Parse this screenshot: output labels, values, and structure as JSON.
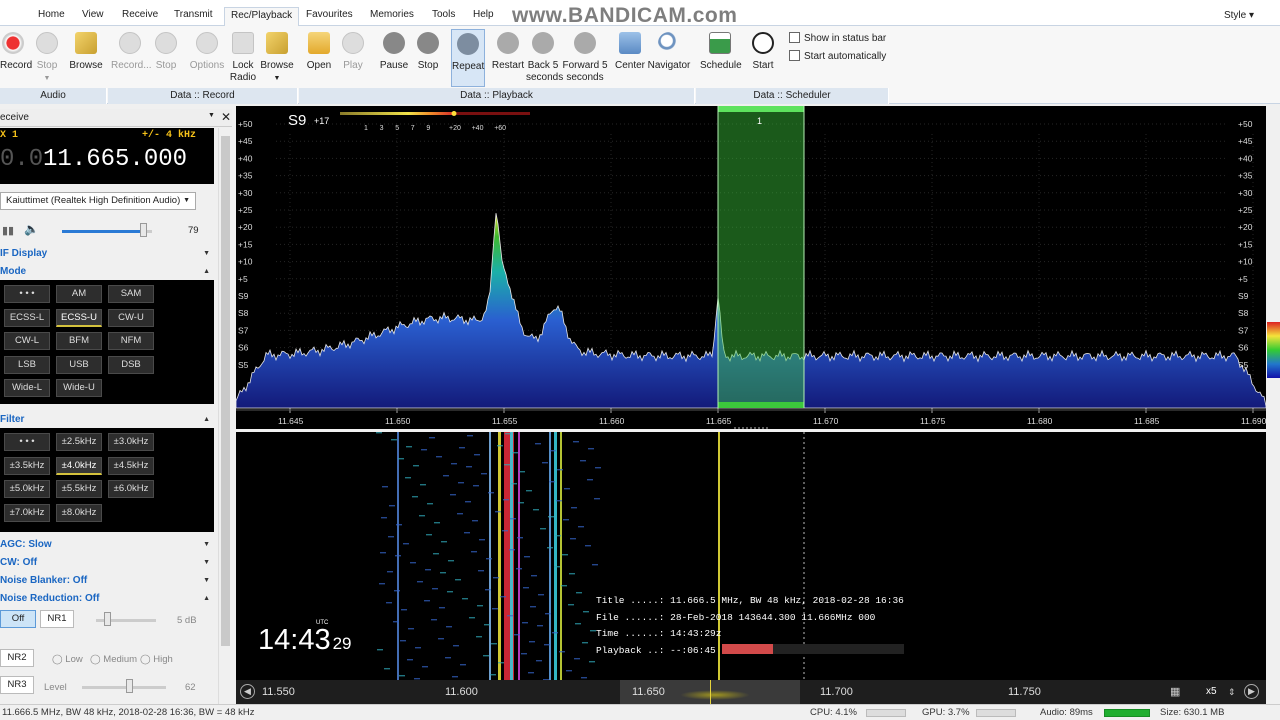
{
  "tabs": [
    "Home",
    "View",
    "Receive",
    "Transmit",
    "Rec/Playback",
    "Favourites",
    "Memories",
    "Tools",
    "Help"
  ],
  "active_tab": "Rec/Playback",
  "watermark": "www.BANDICAM.com",
  "style_menu": "Style",
  "ribbon": {
    "audio": {
      "record": "Record",
      "stop": "Stop",
      "browse": "Browse",
      "label": "Audio"
    },
    "data_record": {
      "record": "Record...",
      "stop": "Stop",
      "options": "Options",
      "lock_radio": "Lock Radio",
      "browse": "Browse",
      "label": "Data :: Record"
    },
    "data_playback": {
      "open": "Open",
      "play": "Play",
      "pause": "Pause",
      "stop": "Stop",
      "repeat": "Repeat",
      "restart": "Restart",
      "back5": "Back 5 seconds",
      "forward5": "Forward 5 seconds",
      "center": "Center",
      "navigator": "Navigator",
      "label": "Data :: Playback"
    },
    "data_scheduler": {
      "schedule": "Schedule",
      "start": "Start",
      "label": "Data :: Scheduler"
    },
    "show_status_bar": "Show in status bar",
    "start_automatically": "Start automatically"
  },
  "left": {
    "receive_title": "eceive",
    "rx_label": "X 1",
    "bw_label": "+/- 4 kHz",
    "freq_dim": "0.0",
    "freq": "11.665.000",
    "audio_device": "Kaiuttimet (Realtek High Definition Audio)",
    "volume": "79",
    "if_display": "IF Display",
    "mode_header": "Mode",
    "modes": [
      [
        "• • •",
        "AM",
        "SAM"
      ],
      [
        "ECSS-L",
        "ECSS-U",
        "CW-U"
      ],
      [
        "CW-L",
        "BFM",
        "NFM"
      ],
      [
        "LSB",
        "USB",
        "DSB"
      ],
      [
        "Wide-L",
        "Wide-U"
      ]
    ],
    "selected_mode": "ECSS-U",
    "filter_header": "Filter",
    "filters": [
      [
        "• • •",
        "±2.5kHz",
        "±3.0kHz"
      ],
      [
        "±3.5kHz",
        "±4.0kHz",
        "±4.5kHz"
      ],
      [
        "±5.0kHz",
        "±5.5kHz",
        "±6.0kHz"
      ],
      [
        "±7.0kHz",
        "±8.0kHz"
      ]
    ],
    "selected_filter": "±4.0kHz",
    "agc": "AGC: Slow",
    "cw": "CW: Off",
    "noise_blanker": "Noise Blanker: Off",
    "noise_reduction": "Noise Reduction: Off",
    "nr_off": "Off",
    "nr1": "NR1",
    "nr1_db": "5 dB",
    "nr2": "NR2",
    "nr3": "NR3",
    "low": "Low",
    "medium": "Medium",
    "high": "High",
    "level": "Level",
    "level_value": "62"
  },
  "spectrum": {
    "signal_level": "S9",
    "signal_over": "+17",
    "meter_ticks": [
      "1",
      "3",
      "5",
      "7",
      "9",
      "+20",
      "+40",
      "+60"
    ],
    "y_labels": [
      "+50",
      "+45",
      "+40",
      "+35",
      "+30",
      "+25",
      "+20",
      "+15",
      "+10",
      "+5",
      "S9",
      "S8",
      "S7",
      "S6",
      "S5"
    ],
    "x_labels": [
      "11.645",
      "11.650",
      "11.655",
      "11.660",
      "11.665",
      "11.670",
      "11.675",
      "11.680",
      "11.685",
      "11.690"
    ],
    "marker": "1"
  },
  "waterfall": {
    "time_hm": "14:43",
    "time_s": "29",
    "utc": "UTC",
    "info": [
      [
        "Title .....:",
        "11.666.5 MHz, BW 48 kHz, 2018-02-28 16:36"
      ],
      [
        "File ......:",
        "28-Feb-2018 143644.300 11.666MHz 000"
      ],
      [
        "Time ......:",
        "14:43:29z"
      ],
      [
        "Playback ..:",
        "--:06:45"
      ]
    ],
    "playback_progress": 0.28,
    "scroll_labels": [
      "11.550",
      "11.600",
      "11.650",
      "11.700",
      "11.750"
    ],
    "zoom": "x5"
  },
  "status": {
    "left": "11.666.5 MHz, BW 48 kHz, 2018-02-28 16:36, BW = 48 kHz",
    "cpu": "CPU: 4.1%",
    "gpu": "GPU: 3.7%",
    "audio": "Audio: 89ms",
    "size": "Size: 630.1 MB"
  }
}
